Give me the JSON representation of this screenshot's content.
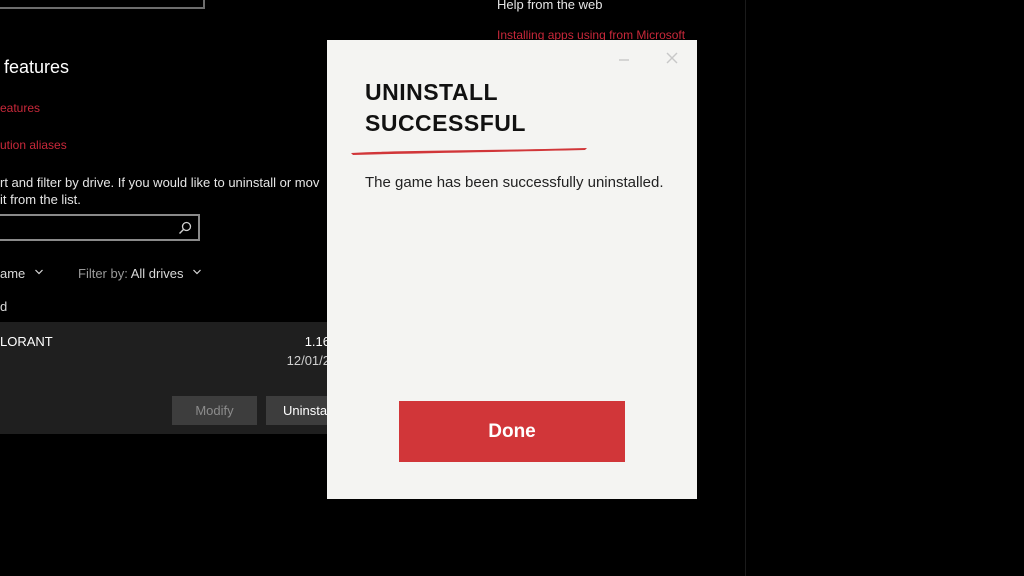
{
  "settings": {
    "section_heading": "features",
    "link_features": "eatures",
    "link_aliases": "ution aliases",
    "description_line1": "rt and filter by drive. If you would like to uninstall or mov",
    "description_line2": "it from the list.",
    "sort_label": "ame",
    "filter_prefix": "Filter by:",
    "filter_value": "All drives",
    "list_count_label": "d",
    "app": {
      "name": "LORANT",
      "size": "1.16",
      "date": "12/01/2",
      "modify_label": "Modify",
      "uninstall_label": "Uninsta"
    },
    "help_from_web": "Help from the web",
    "red_partial_link": "Installing apps using from Microsoft"
  },
  "dialog": {
    "title_line1": "UNINSTALL",
    "title_line2": "SUCCESSFUL",
    "message": "The game has been successfully uninstalled.",
    "done_label": "Done",
    "accent_color": "#d13639"
  }
}
